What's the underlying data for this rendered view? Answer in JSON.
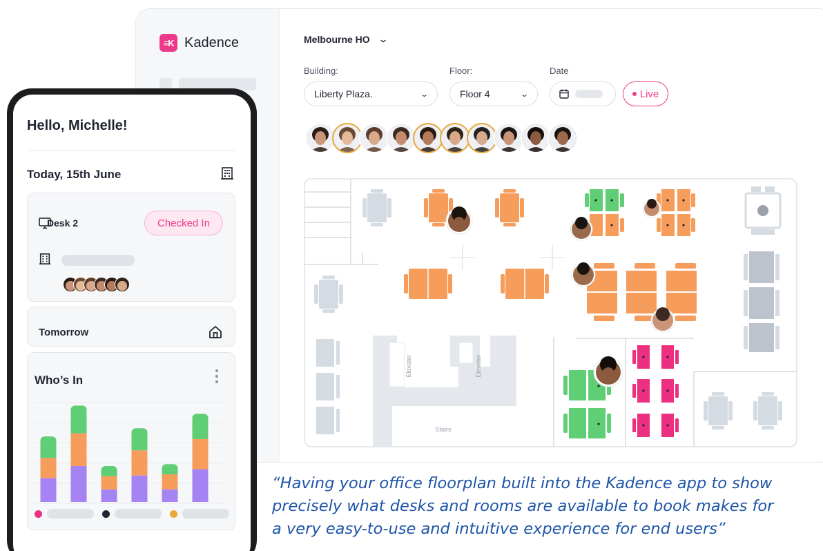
{
  "app": {
    "brand_logo_text": "≡K",
    "brand_name": "Kadence"
  },
  "header": {
    "location": "Melbourne HO"
  },
  "filters": {
    "building_label": "Building:",
    "building_value": "Liberty Plaza.",
    "floor_label": "Floor:",
    "floor_value": "Floor 4",
    "date_label": "Date",
    "live_label": "Live"
  },
  "attendees": [
    {
      "skin": "#c9967a",
      "hair": "#2b1d16",
      "ring": false
    },
    {
      "skin": "#e3b999",
      "hair": "#6b4a2f",
      "ring": true
    },
    {
      "skin": "#d8a98a",
      "hair": "#5a3d2a",
      "ring": false
    },
    {
      "skin": "#c48c6e",
      "hair": "#3a2a22",
      "ring": false
    },
    {
      "skin": "#b57a5a",
      "hair": "#2a1a12",
      "ring": true
    },
    {
      "skin": "#d9a987",
      "hair": "#2f231c",
      "ring": true
    },
    {
      "skin": "#d7ab8d",
      "hair": "#222222",
      "ring": true
    },
    {
      "skin": "#c99477",
      "hair": "#1b1512",
      "ring": false
    },
    {
      "skin": "#8c5a3e",
      "hair": "#140d0a",
      "ring": false
    },
    {
      "skin": "#9b6a4c",
      "hair": "#1a1410",
      "ring": false
    }
  ],
  "floorplan": {
    "elevator_left": "Elevator",
    "elevator_right": "Elevator",
    "stairs": "Stairs",
    "colors": {
      "available": "#f79d5c",
      "booked": "#5fce74",
      "restricted": "#ec2f7f",
      "unavailable": "#d5dbe2"
    }
  },
  "mobile": {
    "greeting": "Hello, Michelle!",
    "date": "Today, 15th June",
    "desk": "Desk 2",
    "status": "Checked In",
    "tomorrow": "Tomorrow",
    "whos_in_title": "Who’s In"
  },
  "chart_data": {
    "type": "bar",
    "stacked": true,
    "title": "Who’s In",
    "categories": [
      "",
      "",
      "",
      "",
      "",
      ""
    ],
    "series": [
      {
        "color": "#a683f2",
        "values": [
          38,
          57,
          20,
          42,
          20,
          52
        ]
      },
      {
        "color": "#f79d5c",
        "values": [
          32,
          52,
          21,
          40,
          24,
          48
        ]
      },
      {
        "color": "#5fce74",
        "values": [
          34,
          44,
          16,
          35,
          16,
          40
        ]
      }
    ],
    "legend_colors": [
      "#ec2f7f",
      "#1f2430",
      "#e9a83a"
    ],
    "grid": true,
    "ylim": [
      0,
      160
    ]
  },
  "quote": {
    "line1": "“Having your office floorplan built into the Kadence app to show",
    "line2": "precisely what desks and rooms are available to book makes for",
    "line3": "a very easy-to-use and intuitive experience for end users”"
  }
}
